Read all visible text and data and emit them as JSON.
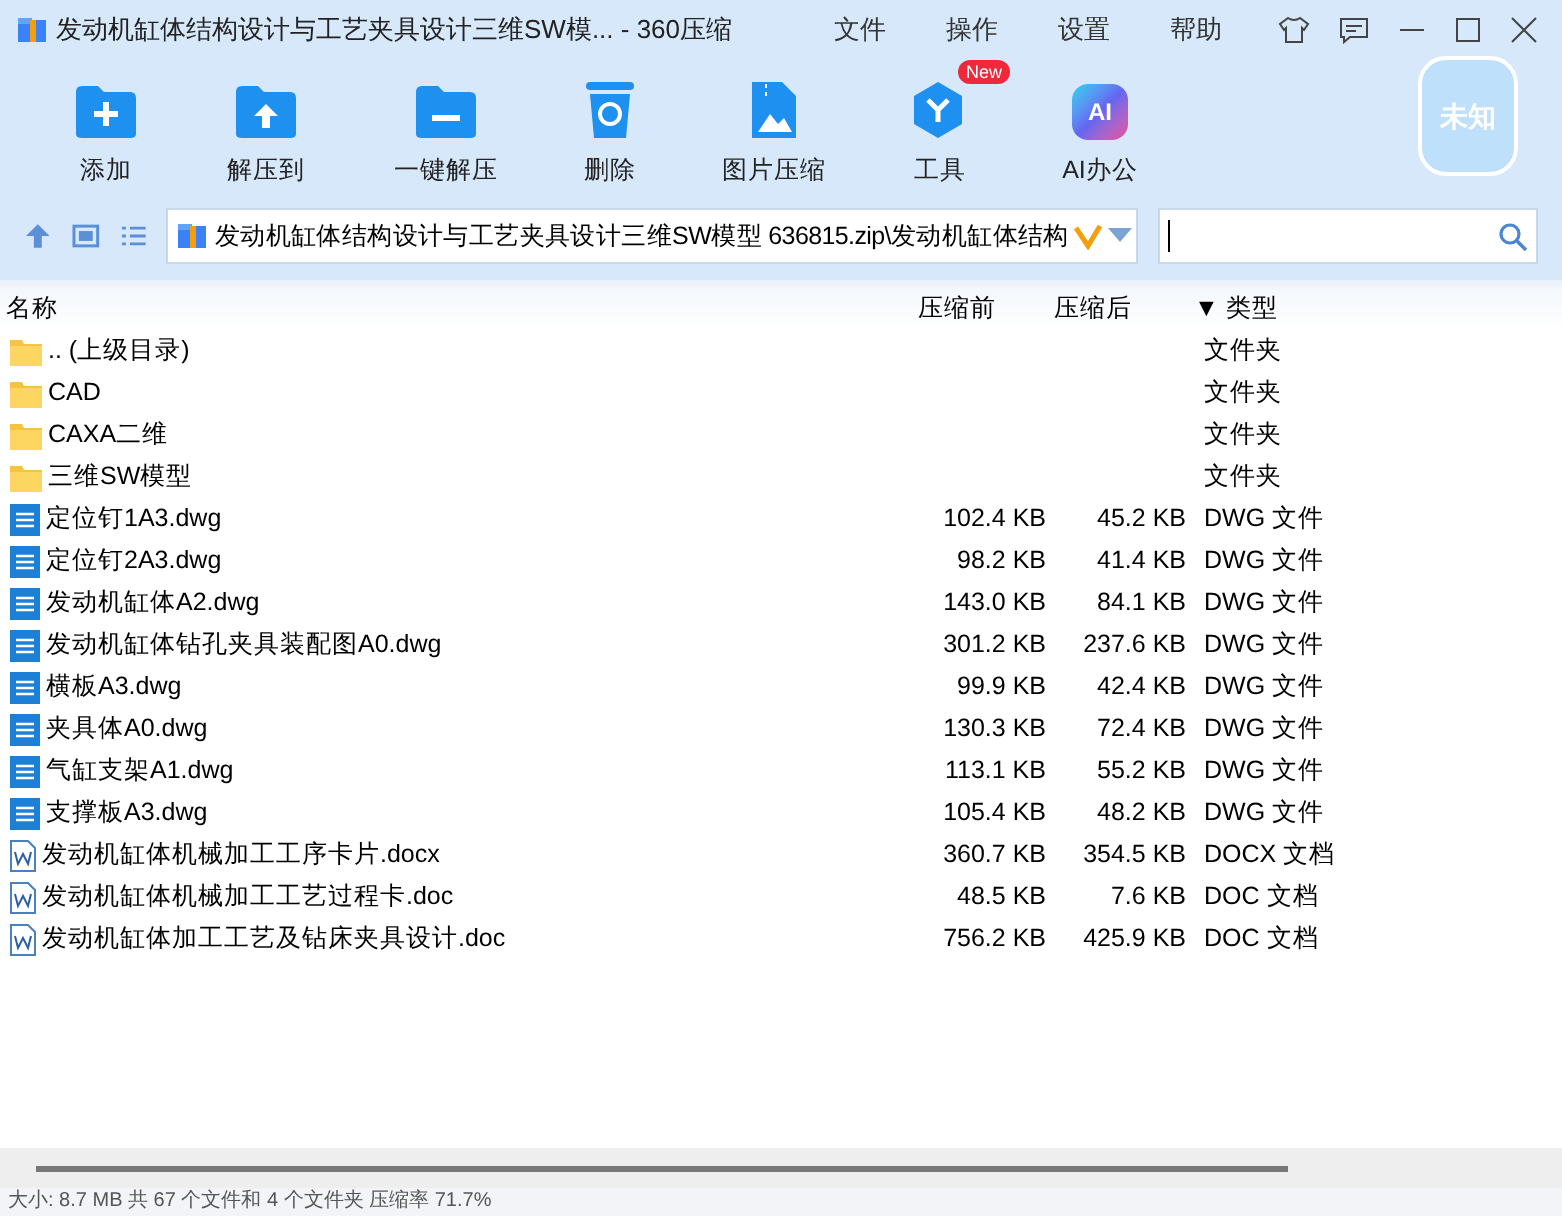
{
  "window": {
    "title": "发动机缸体结构设计与工艺夹具设计三维SW模... - 360压缩"
  },
  "menu": [
    "文件",
    "操作",
    "设置",
    "帮助"
  ],
  "toolbar": [
    {
      "label": "添加",
      "kind": "add"
    },
    {
      "label": "解压到",
      "kind": "extract"
    },
    {
      "label": "一键解压",
      "kind": "oneclick"
    },
    {
      "label": "删除",
      "kind": "delete"
    },
    {
      "label": "图片压缩",
      "kind": "image"
    },
    {
      "label": "工具",
      "kind": "tools",
      "badge": "New"
    },
    {
      "label": "AI办公",
      "kind": "ai",
      "logo": "AI"
    }
  ],
  "shield": "未知",
  "address": {
    "path": "发动机缸体结构设计与工艺夹具设计三维SW模型 636815.zip\\发动机缸体结构"
  },
  "table": {
    "columns": [
      "名称",
      "压缩前",
      "压缩后",
      "▼ 类型"
    ],
    "rows": [
      {
        "kind": "folder",
        "name": ".. (上级目录)",
        "type": "文件夹"
      },
      {
        "kind": "folder",
        "name": "CAD",
        "type": "文件夹"
      },
      {
        "kind": "folder",
        "name": "CAXA二维",
        "type": "文件夹"
      },
      {
        "kind": "folder",
        "name": "三维SW模型",
        "type": "文件夹"
      },
      {
        "kind": "dwg",
        "name": "定位钉1A3.dwg",
        "before": "102.4 KB",
        "after": "45.2 KB",
        "type": "DWG 文件"
      },
      {
        "kind": "dwg",
        "name": "定位钉2A3.dwg",
        "before": "98.2 KB",
        "after": "41.4 KB",
        "type": "DWG 文件"
      },
      {
        "kind": "dwg",
        "name": "发动机缸体A2.dwg",
        "before": "143.0 KB",
        "after": "84.1 KB",
        "type": "DWG 文件"
      },
      {
        "kind": "dwg",
        "name": "发动机缸体钻孔夹具装配图A0.dwg",
        "before": "301.2 KB",
        "after": "237.6 KB",
        "type": "DWG 文件"
      },
      {
        "kind": "dwg",
        "name": "横板A3.dwg",
        "before": "99.9 KB",
        "after": "42.4 KB",
        "type": "DWG 文件"
      },
      {
        "kind": "dwg",
        "name": "夹具体A0.dwg",
        "before": "130.3 KB",
        "after": "72.4 KB",
        "type": "DWG 文件"
      },
      {
        "kind": "dwg",
        "name": "气缸支架A1.dwg",
        "before": "113.1 KB",
        "after": "55.2 KB",
        "type": "DWG 文件"
      },
      {
        "kind": "dwg",
        "name": "支撑板A3.dwg",
        "before": "105.4 KB",
        "after": "48.2 KB",
        "type": "DWG 文件"
      },
      {
        "kind": "doc",
        "name": "发动机缸体机械加工工序卡片.docx",
        "before": "360.7 KB",
        "after": "354.5 KB",
        "type": "DOCX 文档"
      },
      {
        "kind": "doc",
        "name": "发动机缸体机械加工工艺过程卡.doc",
        "before": "48.5 KB",
        "after": "7.6 KB",
        "type": "DOC 文档"
      },
      {
        "kind": "doc",
        "name": "发动机缸体加工工艺及钻床夹具设计.doc",
        "before": "756.2 KB",
        "after": "425.9 KB",
        "type": "DOC 文档"
      }
    ]
  },
  "status_bar": "大小: 8.7 MB 共 67 个文件和 4 个文件夹 压缩率 71.7%"
}
